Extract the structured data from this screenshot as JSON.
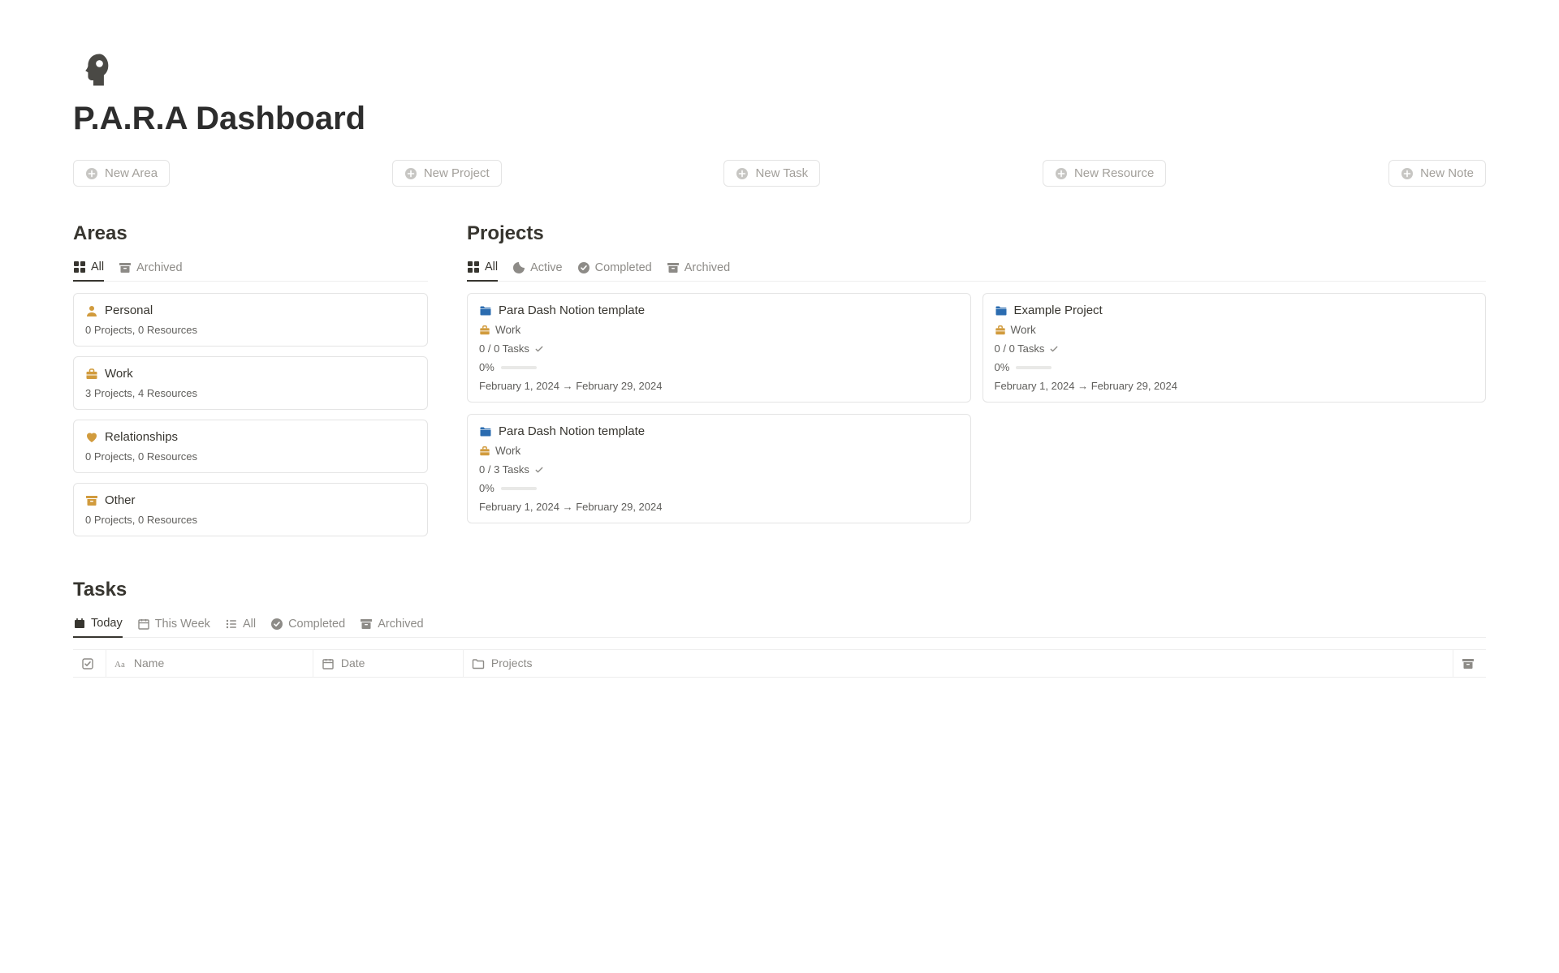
{
  "page": {
    "title": "P.A.R.A Dashboard"
  },
  "newButtons": {
    "area": "New Area",
    "project": "New Project",
    "task": "New Task",
    "resource": "New Resource",
    "note": "New Note"
  },
  "areas": {
    "heading": "Areas",
    "tabs": {
      "all": "All",
      "archived": "Archived"
    },
    "items": [
      {
        "title": "Personal",
        "meta": "0 Projects, 0 Resources"
      },
      {
        "title": "Work",
        "meta": "3 Projects, 4 Resources"
      },
      {
        "title": "Relationships",
        "meta": "0 Projects, 0 Resources"
      },
      {
        "title": "Other",
        "meta": "0 Projects, 0 Resources"
      }
    ]
  },
  "projects": {
    "heading": "Projects",
    "tabs": {
      "all": "All",
      "active": "Active",
      "completed": "Completed",
      "archived": "Archived"
    },
    "items": [
      {
        "title": "Para Dash Notion template",
        "area": "Work",
        "tasks": "0 / 0 Tasks",
        "percent": "0%",
        "date": "February 1, 2024 → February 29, 2024"
      },
      {
        "title": "Example Project",
        "area": "Work",
        "tasks": "0 / 0 Tasks",
        "percent": "0%",
        "date": "February 1, 2024 → February 29, 2024"
      },
      {
        "title": "Para Dash Notion template",
        "area": "Work",
        "tasks": "0 / 3 Tasks",
        "percent": "0%",
        "date": "February 1, 2024 → February 29, 2024"
      }
    ]
  },
  "tasks": {
    "heading": "Tasks",
    "tabs": {
      "today": "Today",
      "thisWeek": "This Week",
      "all": "All",
      "completed": "Completed",
      "archived": "Archived"
    },
    "columns": {
      "name": "Name",
      "date": "Date",
      "projects": "Projects"
    }
  }
}
